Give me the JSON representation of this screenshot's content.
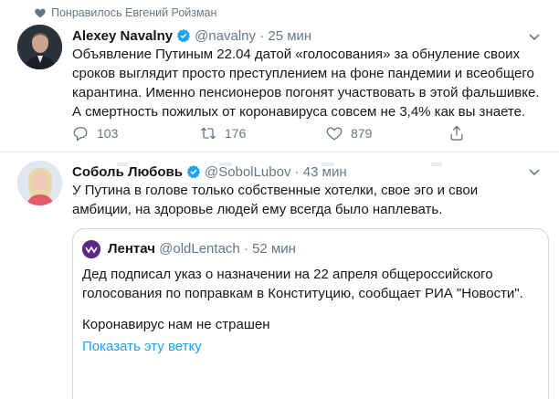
{
  "social_context": {
    "text": "Понравилось Евгений Ройзман",
    "icon": "heart-icon"
  },
  "tweets": [
    {
      "name": "Alexey Navalny",
      "handle": "@navalny",
      "separator": "·",
      "time": "25 мин",
      "lines": [
        "Объявление Путиным 22.04 датой «голосования» за обнуление своих",
        "сроков выглядит просто преступлением на фоне пандемии и всеобщего",
        "карантина. Именно пенсионеров погонят участвовать в этой фальшивке.",
        "А смертность пожилых от коронавируса совсем не 3,4% как вы знаете."
      ],
      "reply_count": "103",
      "retweet_count": "176",
      "like_count": "879"
    },
    {
      "name": "Соболь Любовь",
      "handle": "@SobolLubov",
      "separator": "·",
      "time": "43 мин",
      "lines": [
        "У Путина в голове только собственные хотелки, свое эго и свои",
        "амбиции, на здоровье людей ему всегда было наплевать."
      ],
      "quote": {
        "name": "Лентач",
        "handle": "@oldLentach",
        "separator": "·",
        "time": "52 мин",
        "lines": [
          "Дед подписал указ о назначении на 22 апреля общероссийского",
          "голосования по поправкам в Конституцию, сообщает РИА \"Новости\"."
        ],
        "line2": "Коронавирус нам не страшен",
        "show_thread": "Показать эту ветку"
      }
    }
  ],
  "colors": {
    "accent": "#1da1f2",
    "secondary_text": "#657786",
    "border": "#e6ecf0"
  }
}
